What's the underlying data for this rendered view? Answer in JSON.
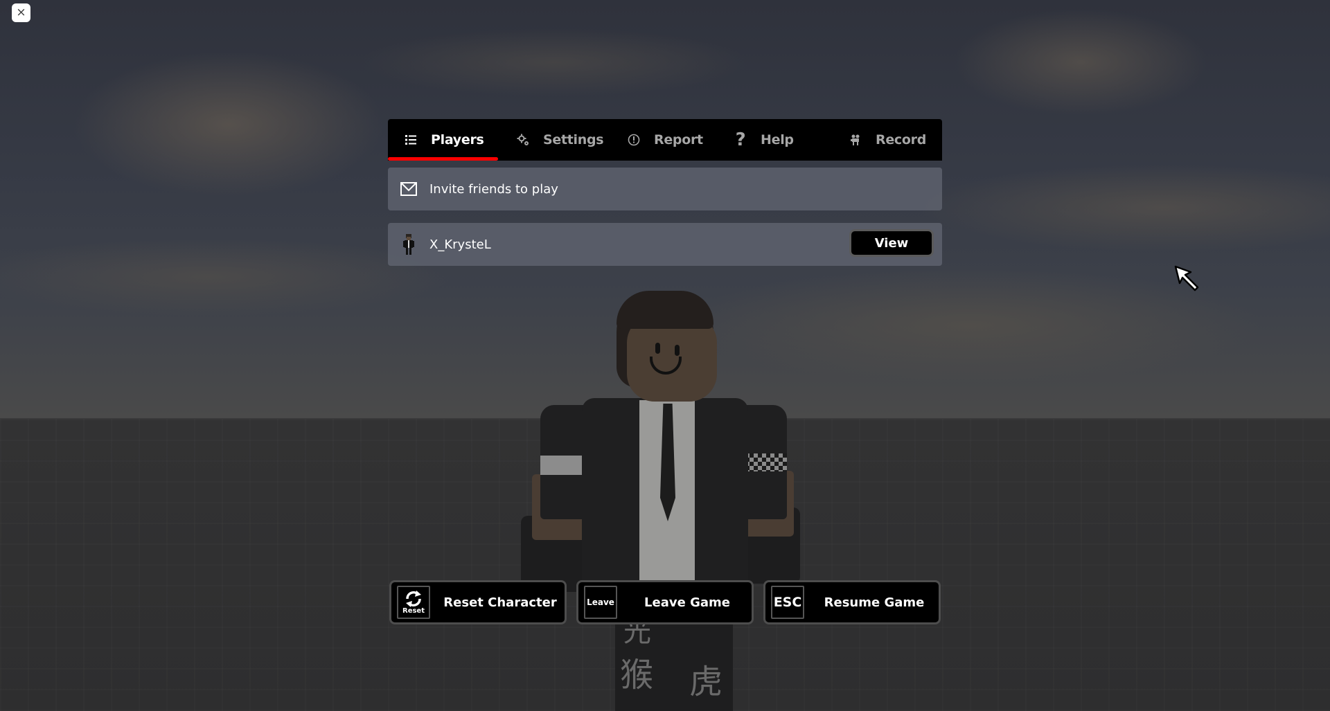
{
  "window": {
    "close_label": "×"
  },
  "tabs": [
    {
      "label": "Players",
      "icon": "player-list-icon",
      "active": true
    },
    {
      "label": "Settings",
      "icon": "gear-icon",
      "active": false
    },
    {
      "label": "Report",
      "icon": "report-icon",
      "active": false
    },
    {
      "label": "Help",
      "icon": "help-icon",
      "active": false
    },
    {
      "label": "Record",
      "icon": "record-camera-icon",
      "active": false
    }
  ],
  "colors": {
    "tab_active_underline": "#ff0000",
    "tabbar_bg": "#000000",
    "tab_active_text": "#ffffff",
    "tab_inactive_text": "#a7a7a7"
  },
  "invite": {
    "label": "Invite friends to play",
    "icon": "envelope-icon"
  },
  "players": [
    {
      "name": "X_KrysteL",
      "icon": "player-avatar-icon",
      "view_label": "View"
    }
  ],
  "actions": [
    {
      "key": "Reset",
      "label": "Reset Character",
      "icon": "reset-icon"
    },
    {
      "key": "Leave",
      "label": "Leave Game",
      "icon": "leave-icon"
    },
    {
      "key": "ESC",
      "label": "Resume Game",
      "icon": "esc-key-icon"
    }
  ],
  "scene": {
    "kanji": [
      "猴",
      "虎",
      "光"
    ]
  }
}
